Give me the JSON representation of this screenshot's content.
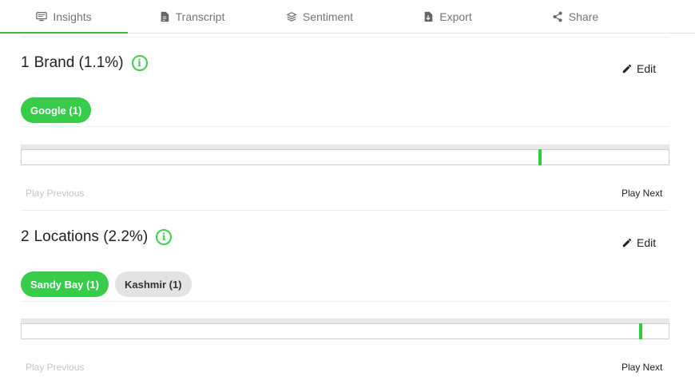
{
  "tabs": [
    {
      "label": "Insights",
      "icon": "monitor-icon",
      "active": true
    },
    {
      "label": "Transcript",
      "icon": "document-icon",
      "active": false
    },
    {
      "label": "Sentiment",
      "icon": "layers-icon",
      "active": false
    },
    {
      "label": "Export",
      "icon": "download-file-icon",
      "active": false
    },
    {
      "label": "Share",
      "icon": "share-icon",
      "active": false
    }
  ],
  "sections": [
    {
      "count": "1",
      "title": "Brand (1.1%)",
      "edit_label": "Edit",
      "chips": [
        {
          "label": "Google (1)",
          "selected": true
        }
      ],
      "marker_position": 0.799,
      "play_previous": "Play Previous",
      "play_next": "Play Next"
    },
    {
      "count": "2",
      "title": "Locations (2.2%)",
      "edit_label": "Edit",
      "chips": [
        {
          "label": "Sandy Bay (1)",
          "selected": true
        },
        {
          "label": "Kashmir (1)",
          "selected": false
        }
      ],
      "marker_position": 0.954,
      "play_previous": "Play Previous",
      "play_next": "Play Next"
    }
  ],
  "colors": {
    "accent": "#37cc4a",
    "chip_off": "#e3e3e3",
    "muted_text": "#c4c4c4"
  }
}
